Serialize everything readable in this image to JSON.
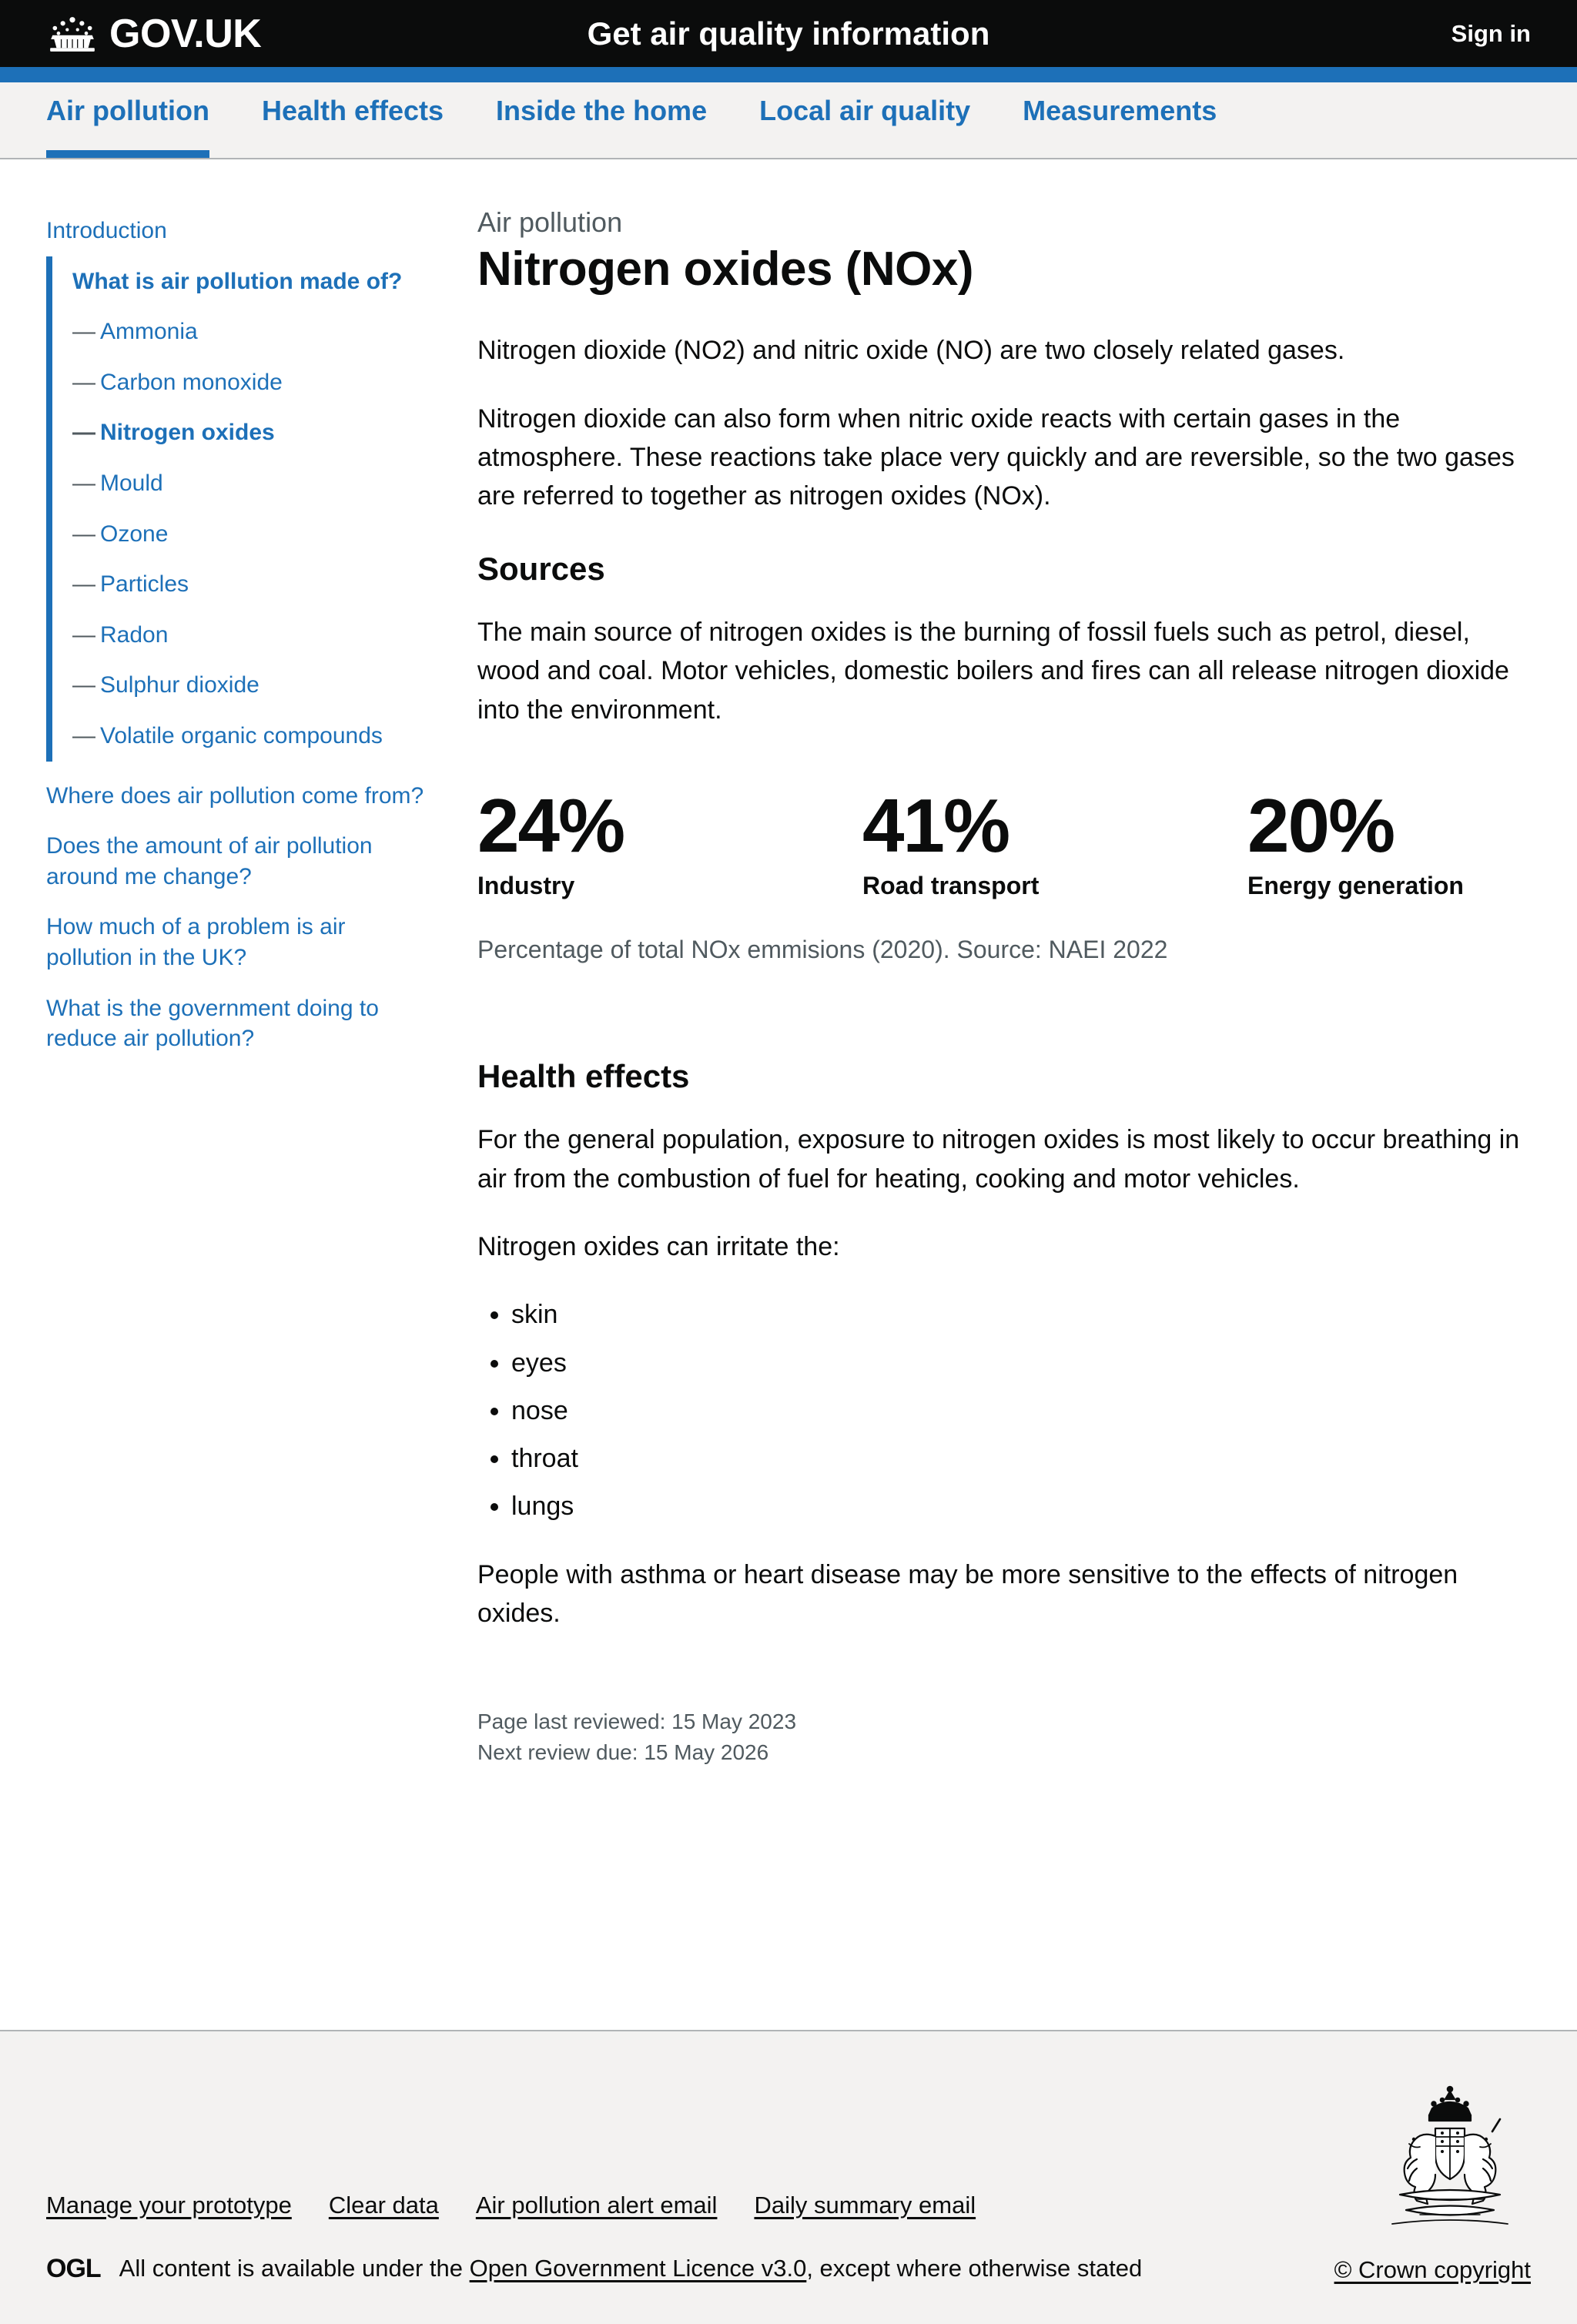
{
  "header": {
    "brand": "GOV.UK",
    "crown_icon": "crown-icon",
    "service_name": "Get air quality information",
    "sign_in": "Sign in"
  },
  "service_nav": {
    "items": [
      {
        "label": "Air pollution",
        "active": true
      },
      {
        "label": "Health effects",
        "active": false
      },
      {
        "label": "Inside the home",
        "active": false
      },
      {
        "label": "Local air quality",
        "active": false
      },
      {
        "label": "Measurements",
        "active": false
      }
    ]
  },
  "sidebar": {
    "intro": "Introduction",
    "group_title": "What is air pollution made of?",
    "sub_items": [
      "Ammonia",
      "Carbon monoxide",
      "Nitrogen oxides",
      "Mould",
      "Ozone",
      "Particles",
      "Radon",
      "Sulphur dioxide",
      "Volatile organic compounds"
    ],
    "active_sub": "Nitrogen oxides",
    "after_items": [
      "Where does air pollution come from?",
      "Does the amount of air pollution around me change?",
      "How much of a problem is air pollution in the UK?",
      "What is the government doing to reduce air pollution?"
    ]
  },
  "main": {
    "caption": "Air pollution",
    "title": "Nitrogen oxides (NOx)",
    "intro_p1": "Nitrogen dioxide (NO2) and nitric oxide (NO) are two closely related gases.",
    "intro_p2": "Nitrogen dioxide can also form when nitric oxide reacts with certain gases in the atmosphere. These reactions take place very quickly and are reversible, so the two gases are referred to together as nitrogen oxides (NOx).",
    "sources_heading": "Sources",
    "sources_p": "The main source of nitrogen oxides is the burning of fossil fuels such as petrol, diesel, wood and coal. Motor vehicles, domestic boilers and fires can all release nitrogen dioxide into the environment.",
    "stats_source": "Percentage of total NOx emmisions (2020). Source: NAEI 2022",
    "health_heading": "Health effects",
    "health_p1": "For the general population, exposure to nitrogen oxides is most likely to occur breathing in air from the combustion of fuel for heating, cooking and motor vehicles.",
    "health_p2": "Nitrogen oxides can irritate the:",
    "irritate_list": [
      "skin",
      "eyes",
      "nose",
      "throat",
      "lungs"
    ],
    "health_p3": "People with asthma or heart disease may be more sensitive to the effects of nitrogen oxides.",
    "page_last_reviewed": "Page last reviewed: 15 May 2023",
    "next_review_due": "Next review due: 15 May 2026"
  },
  "chart_data": {
    "type": "bar",
    "title": "Percentage of total NOx emmisions (2020)",
    "subtitle": "Source: NAEI 2022",
    "categories": [
      "Industry",
      "Road transport",
      "Energy generation"
    ],
    "values": [
      24,
      41,
      20
    ],
    "value_labels": [
      "24%",
      "41%",
      "20%"
    ],
    "unit": "%",
    "ylabel": "Percentage of total NOx emmisions",
    "xlabel": "",
    "ylim": [
      0,
      100
    ],
    "grid": false,
    "legend": "none"
  },
  "footer": {
    "links": [
      "Manage your prototype",
      "Clear data",
      "Air pollution alert email",
      "Daily summary email"
    ],
    "ogl_logo": "OGL",
    "licence_prefix": "All content is available under the ",
    "licence_link": "Open Government Licence v3.0",
    "licence_suffix": ", except where otherwise stated",
    "crown_copyright": "© Crown copyright",
    "arms_icon": "royal-coat-of-arms-icon"
  },
  "colors": {
    "brand_black": "#0b0c0c",
    "accent_blue": "#1d70b8",
    "grey_text": "#505a5f",
    "footer_bg": "#f3f2f1",
    "border_grey": "#b1b4b6"
  }
}
